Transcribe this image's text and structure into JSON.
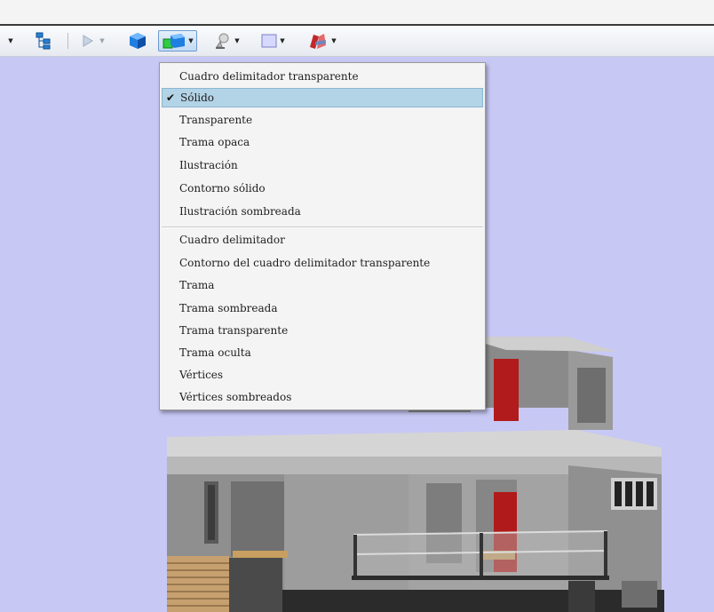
{
  "toolbar": {
    "icons": [
      "dropdown-arrow-icon",
      "tree-view-icon",
      "play-icon",
      "solid-cube-icon",
      "render-mode-icon",
      "light-icon",
      "background-color-icon",
      "section-icon"
    ]
  },
  "menu": {
    "selected_index": 1,
    "group1": [
      "Cuadro delimitador transparente",
      "Sólido",
      "Transparente",
      "Trama opaca",
      "Ilustración",
      "Contorno sólido",
      "Ilustración sombreada"
    ],
    "group2": [
      "Cuadro delimitador",
      "Contorno del cuadro delimitador transparente",
      "Trama",
      "Trama sombreada",
      "Trama transparente",
      "Trama oculta",
      "Vértices",
      "Vértices sombreados"
    ]
  },
  "colors": {
    "viewport_bg": "#c7c8f4",
    "menu_highlight": "#b3d3e6",
    "wall_gray": "#8a8a8a",
    "accent_red": "#b11a1a"
  }
}
